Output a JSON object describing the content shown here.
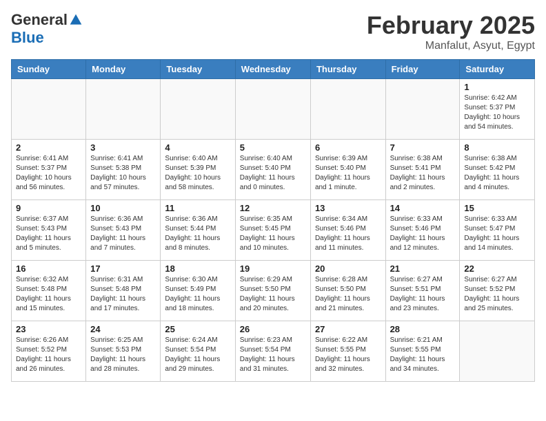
{
  "header": {
    "logo_line1": "General",
    "logo_line2": "Blue",
    "month": "February 2025",
    "location": "Manfalut, Asyut, Egypt"
  },
  "days_of_week": [
    "Sunday",
    "Monday",
    "Tuesday",
    "Wednesday",
    "Thursday",
    "Friday",
    "Saturday"
  ],
  "weeks": [
    [
      {
        "day": "",
        "info": ""
      },
      {
        "day": "",
        "info": ""
      },
      {
        "day": "",
        "info": ""
      },
      {
        "day": "",
        "info": ""
      },
      {
        "day": "",
        "info": ""
      },
      {
        "day": "",
        "info": ""
      },
      {
        "day": "1",
        "info": "Sunrise: 6:42 AM\nSunset: 5:37 PM\nDaylight: 10 hours\nand 54 minutes."
      }
    ],
    [
      {
        "day": "2",
        "info": "Sunrise: 6:41 AM\nSunset: 5:37 PM\nDaylight: 10 hours\nand 56 minutes."
      },
      {
        "day": "3",
        "info": "Sunrise: 6:41 AM\nSunset: 5:38 PM\nDaylight: 10 hours\nand 57 minutes."
      },
      {
        "day": "4",
        "info": "Sunrise: 6:40 AM\nSunset: 5:39 PM\nDaylight: 10 hours\nand 58 minutes."
      },
      {
        "day": "5",
        "info": "Sunrise: 6:40 AM\nSunset: 5:40 PM\nDaylight: 11 hours\nand 0 minutes."
      },
      {
        "day": "6",
        "info": "Sunrise: 6:39 AM\nSunset: 5:40 PM\nDaylight: 11 hours\nand 1 minute."
      },
      {
        "day": "7",
        "info": "Sunrise: 6:38 AM\nSunset: 5:41 PM\nDaylight: 11 hours\nand 2 minutes."
      },
      {
        "day": "8",
        "info": "Sunrise: 6:38 AM\nSunset: 5:42 PM\nDaylight: 11 hours\nand 4 minutes."
      }
    ],
    [
      {
        "day": "9",
        "info": "Sunrise: 6:37 AM\nSunset: 5:43 PM\nDaylight: 11 hours\nand 5 minutes."
      },
      {
        "day": "10",
        "info": "Sunrise: 6:36 AM\nSunset: 5:43 PM\nDaylight: 11 hours\nand 7 minutes."
      },
      {
        "day": "11",
        "info": "Sunrise: 6:36 AM\nSunset: 5:44 PM\nDaylight: 11 hours\nand 8 minutes."
      },
      {
        "day": "12",
        "info": "Sunrise: 6:35 AM\nSunset: 5:45 PM\nDaylight: 11 hours\nand 10 minutes."
      },
      {
        "day": "13",
        "info": "Sunrise: 6:34 AM\nSunset: 5:46 PM\nDaylight: 11 hours\nand 11 minutes."
      },
      {
        "day": "14",
        "info": "Sunrise: 6:33 AM\nSunset: 5:46 PM\nDaylight: 11 hours\nand 12 minutes."
      },
      {
        "day": "15",
        "info": "Sunrise: 6:33 AM\nSunset: 5:47 PM\nDaylight: 11 hours\nand 14 minutes."
      }
    ],
    [
      {
        "day": "16",
        "info": "Sunrise: 6:32 AM\nSunset: 5:48 PM\nDaylight: 11 hours\nand 15 minutes."
      },
      {
        "day": "17",
        "info": "Sunrise: 6:31 AM\nSunset: 5:48 PM\nDaylight: 11 hours\nand 17 minutes."
      },
      {
        "day": "18",
        "info": "Sunrise: 6:30 AM\nSunset: 5:49 PM\nDaylight: 11 hours\nand 18 minutes."
      },
      {
        "day": "19",
        "info": "Sunrise: 6:29 AM\nSunset: 5:50 PM\nDaylight: 11 hours\nand 20 minutes."
      },
      {
        "day": "20",
        "info": "Sunrise: 6:28 AM\nSunset: 5:50 PM\nDaylight: 11 hours\nand 21 minutes."
      },
      {
        "day": "21",
        "info": "Sunrise: 6:27 AM\nSunset: 5:51 PM\nDaylight: 11 hours\nand 23 minutes."
      },
      {
        "day": "22",
        "info": "Sunrise: 6:27 AM\nSunset: 5:52 PM\nDaylight: 11 hours\nand 25 minutes."
      }
    ],
    [
      {
        "day": "23",
        "info": "Sunrise: 6:26 AM\nSunset: 5:52 PM\nDaylight: 11 hours\nand 26 minutes."
      },
      {
        "day": "24",
        "info": "Sunrise: 6:25 AM\nSunset: 5:53 PM\nDaylight: 11 hours\nand 28 minutes."
      },
      {
        "day": "25",
        "info": "Sunrise: 6:24 AM\nSunset: 5:54 PM\nDaylight: 11 hours\nand 29 minutes."
      },
      {
        "day": "26",
        "info": "Sunrise: 6:23 AM\nSunset: 5:54 PM\nDaylight: 11 hours\nand 31 minutes."
      },
      {
        "day": "27",
        "info": "Sunrise: 6:22 AM\nSunset: 5:55 PM\nDaylight: 11 hours\nand 32 minutes."
      },
      {
        "day": "28",
        "info": "Sunrise: 6:21 AM\nSunset: 5:55 PM\nDaylight: 11 hours\nand 34 minutes."
      },
      {
        "day": "",
        "info": ""
      }
    ]
  ]
}
